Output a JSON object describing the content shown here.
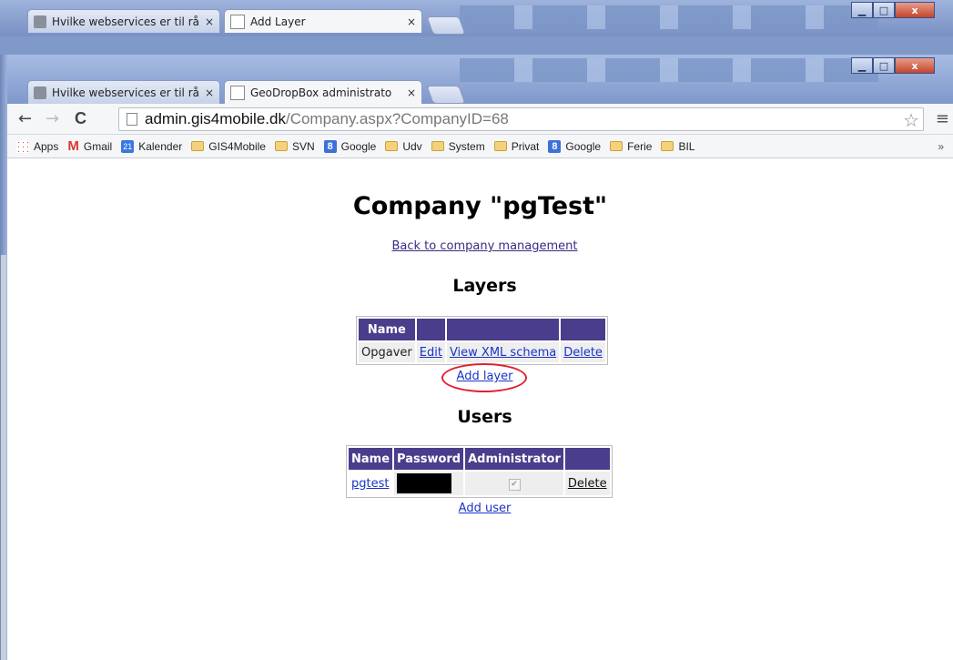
{
  "back_window": {
    "tabs": [
      {
        "label": "Hvilke webservices er til rå"
      },
      {
        "label": "Add Layer"
      }
    ]
  },
  "front_window": {
    "tabs": [
      {
        "label": "Hvilke webservices er til rå"
      },
      {
        "label": "GeoDropBox administrato"
      }
    ],
    "close_glyph": "×",
    "window_controls": {
      "minimize": "▁",
      "maximize": "□",
      "close": "x"
    }
  },
  "toolbar": {
    "url_host": "admin.gis4mobile.dk",
    "url_path": "/Company.aspx?CompanyID=68",
    "back_glyph": "←",
    "forward_glyph": "→",
    "reload_glyph": "C",
    "star_glyph": "☆",
    "menu_glyph": "≡"
  },
  "bookmarks": {
    "items": [
      {
        "label": "Apps",
        "icon": "apps-icon"
      },
      {
        "label": "Gmail",
        "icon": "gmail-icon"
      },
      {
        "label": "Kalender",
        "icon": "calendar-icon"
      },
      {
        "label": "GIS4Mobile",
        "icon": "folder-icon"
      },
      {
        "label": "SVN",
        "icon": "folder-icon"
      },
      {
        "label": "Google",
        "icon": "google-icon"
      },
      {
        "label": "Udv",
        "icon": "folder-icon"
      },
      {
        "label": "System",
        "icon": "folder-icon"
      },
      {
        "label": "Privat",
        "icon": "folder-icon"
      },
      {
        "label": "Google",
        "icon": "google-icon"
      },
      {
        "label": "Ferie",
        "icon": "folder-icon"
      },
      {
        "label": "BIL",
        "icon": "folder-icon"
      }
    ],
    "gmail_glyph": "M",
    "google_glyph": "8",
    "calendar_glyph": "21",
    "overflow_glyph": "»"
  },
  "page": {
    "title": "Company \"pgTest\"",
    "back_link": "Back to company management",
    "layers_heading": "Layers",
    "layers_table": {
      "headers": [
        "Name",
        "",
        "",
        ""
      ],
      "rows": [
        {
          "name": "Opgaver",
          "edit": "Edit",
          "schema": "View XML schema",
          "delete": "Delete"
        }
      ]
    },
    "add_layer": "Add layer",
    "users_heading": "Users",
    "users_table": {
      "headers": [
        "Name",
        "Password",
        "Administrator",
        ""
      ],
      "rows": [
        {
          "name": "pgtest",
          "administrator_checked": true,
          "check_glyph": "✔",
          "delete": "Delete"
        }
      ]
    },
    "add_user": "Add user"
  },
  "colors": {
    "table_header_bg": "#4a3d8c",
    "link": "#1a33c8",
    "highlight": "#e0202e"
  }
}
